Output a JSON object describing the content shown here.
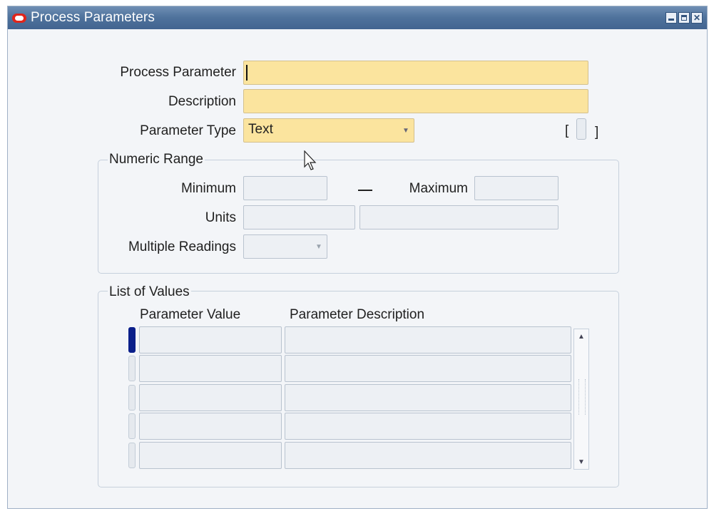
{
  "window": {
    "title": "Process Parameters",
    "controls": [
      "minimize",
      "maximize",
      "close"
    ]
  },
  "form": {
    "process_parameter": {
      "label": "Process Parameter",
      "value": ""
    },
    "description": {
      "label": "Description",
      "value": ""
    },
    "parameter_type": {
      "label": "Parameter Type",
      "value": "Text"
    },
    "flex_field": {
      "open": "[",
      "close": "]"
    }
  },
  "numeric_range": {
    "title": "Numeric Range",
    "minimum_label": "Minimum",
    "maximum_label": "Maximum",
    "units_label": "Units",
    "multiple_readings_label": "Multiple Readings"
  },
  "list_of_values": {
    "title": "List of Values",
    "columns": [
      "Parameter Value",
      "Parameter Description"
    ],
    "rows": [
      {
        "value": "",
        "description": ""
      },
      {
        "value": "",
        "description": ""
      },
      {
        "value": "",
        "description": ""
      },
      {
        "value": "",
        "description": ""
      },
      {
        "value": "",
        "description": ""
      }
    ]
  },
  "colors": {
    "titlebar": "#4f729c",
    "required_field": "#fbe49e",
    "current_row_indicator": "#0b1f8a"
  },
  "icons": [
    "oracle-logo-icon",
    "minimize-icon",
    "maximize-icon",
    "close-icon",
    "dropdown-arrow-icon",
    "scroll-up-icon",
    "scroll-down-icon",
    "mouse-pointer-icon"
  ]
}
